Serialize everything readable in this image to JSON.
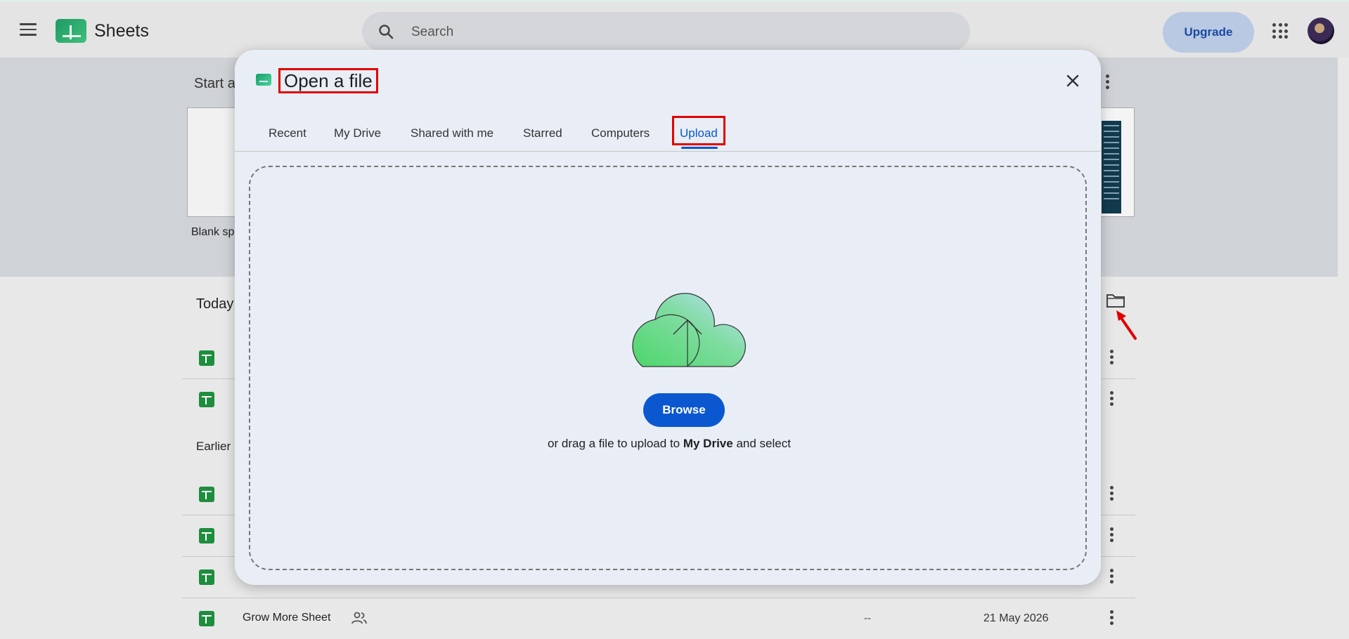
{
  "app": {
    "name": "Sheets",
    "search_placeholder": "Search",
    "upgrade_label": "Upgrade"
  },
  "gallery": {
    "title_partial": "Start a",
    "blank_label_partial": "Blank sp"
  },
  "files": {
    "today_label_partial": "Today",
    "earlier_label_partial": "Earlier",
    "last_row": {
      "name": "Grow More Sheet",
      "owner": "--",
      "date": "21 May 2026"
    }
  },
  "dialog": {
    "title": "Open a file",
    "tabs": [
      {
        "label": "Recent"
      },
      {
        "label": "My Drive"
      },
      {
        "label": "Shared with me"
      },
      {
        "label": "Starred"
      },
      {
        "label": "Computers"
      },
      {
        "label": "Upload",
        "active": true
      }
    ],
    "browse_label": "Browse",
    "drag_text_before": "or drag a file to upload to ",
    "drag_text_bold": "My Drive",
    "drag_text_after": " and select"
  },
  "colors": {
    "accent": "#0b57d0",
    "highlight_box": "#e00000",
    "dialog_bg": "#e9eef6"
  },
  "icons": [
    "menu-icon",
    "sheets-logo-icon",
    "search-icon",
    "apps-grid-icon",
    "close-icon",
    "cloud-upload-icon",
    "folder-icon",
    "more-vert-icon",
    "shared-people-icon",
    "sheets-file-icon"
  ]
}
